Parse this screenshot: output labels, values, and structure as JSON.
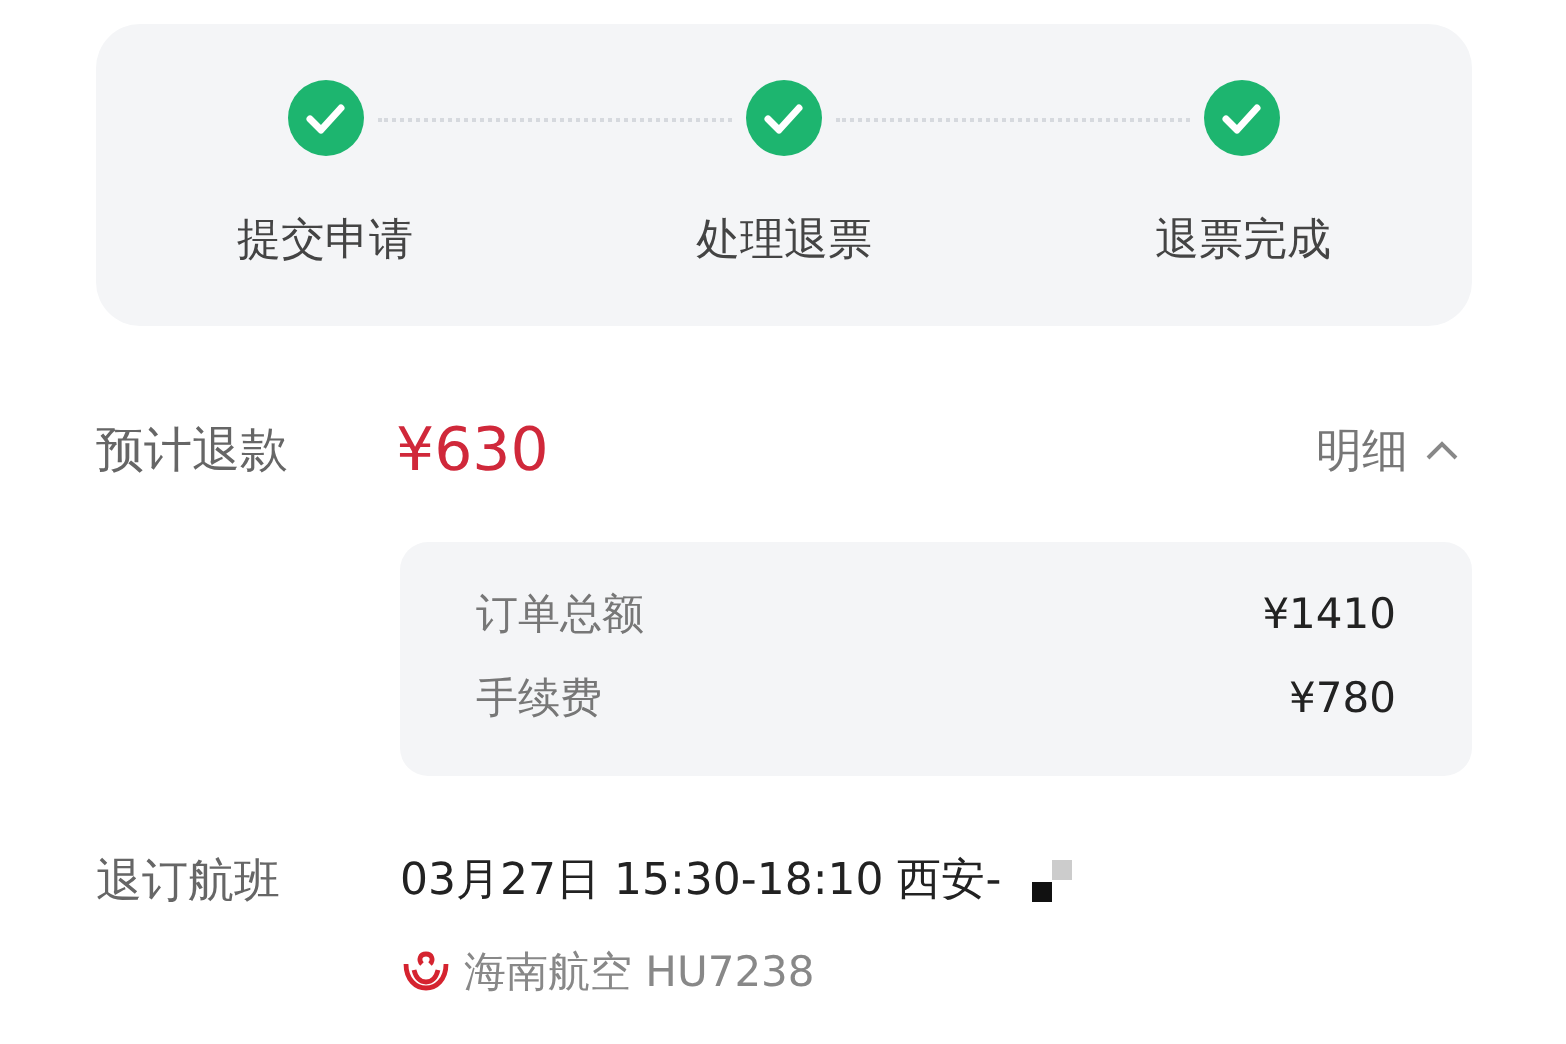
{
  "steps": [
    {
      "label": "提交申请",
      "done": true
    },
    {
      "label": "处理退票",
      "done": true
    },
    {
      "label": "退票完成",
      "done": true
    }
  ],
  "refund": {
    "label": "预计退款",
    "amount": "¥630",
    "detail_toggle": {
      "label": "明细",
      "expanded": true
    }
  },
  "details": [
    {
      "label": "订单总额",
      "value": "¥1410"
    },
    {
      "label": "手续费",
      "value": "¥780"
    }
  ],
  "flight": {
    "label": "退订航班",
    "schedule": "03月27日 15:30-18:10 西安-",
    "airline": "海南航空 HU7238"
  }
}
